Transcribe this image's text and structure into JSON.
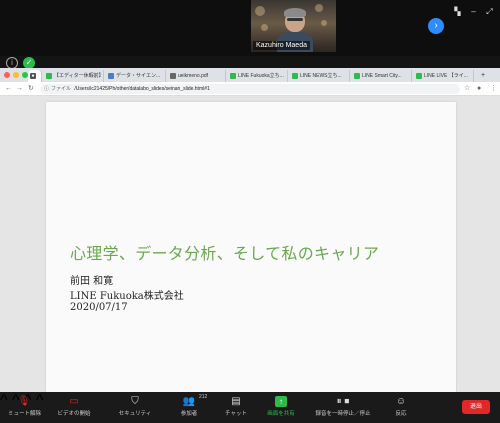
{
  "zoom": {
    "participant_name": "Kazuhiro Maeda"
  },
  "browser": {
    "tabs": [
      {
        "label": "【エディター休暇前】",
        "icon_color": "#2dbb4a"
      },
      {
        "label": "データ・サイエン...",
        "icon_color": "#4a7bd0"
      },
      {
        "label": "ueikmeno.pdf",
        "icon_color": "#666666"
      },
      {
        "label": "LINE Fukuoka立ち...",
        "icon_color": "#2dbb4a"
      },
      {
        "label": "LINE NEWS立ち...",
        "icon_color": "#2dbb4a"
      },
      {
        "label": "LINE Smart City...",
        "icon_color": "#2dbb4a"
      },
      {
        "label": "LINE LIVE 【ライ...",
        "icon_color": "#2dbb4a"
      }
    ],
    "address": {
      "file_label": "ファイル",
      "path": "/Users/ic21425/Ph/other/datalabo_slides/seinan_slide.html#1"
    }
  },
  "slide": {
    "title": "心理学、データ分析、そして私のキャリア",
    "author": "前田 和寛",
    "company": "LINE Fukuoka株式会社",
    "date": "2020/07/17"
  },
  "controls": {
    "mute": "ミュート解除",
    "video": "ビデオの開始",
    "security": "セキュリティ",
    "participants": "参加者",
    "participant_count": "212",
    "chat": "チャット",
    "share": "画面を共有",
    "record": "録音を一時停止／停止",
    "reactions": "反応",
    "end": "退出"
  },
  "colors": {
    "accent_green": "#2dbb4a",
    "slide_title": "#6aa84f",
    "end_red": "#e02828",
    "zoom_blue": "#2d8cff"
  }
}
